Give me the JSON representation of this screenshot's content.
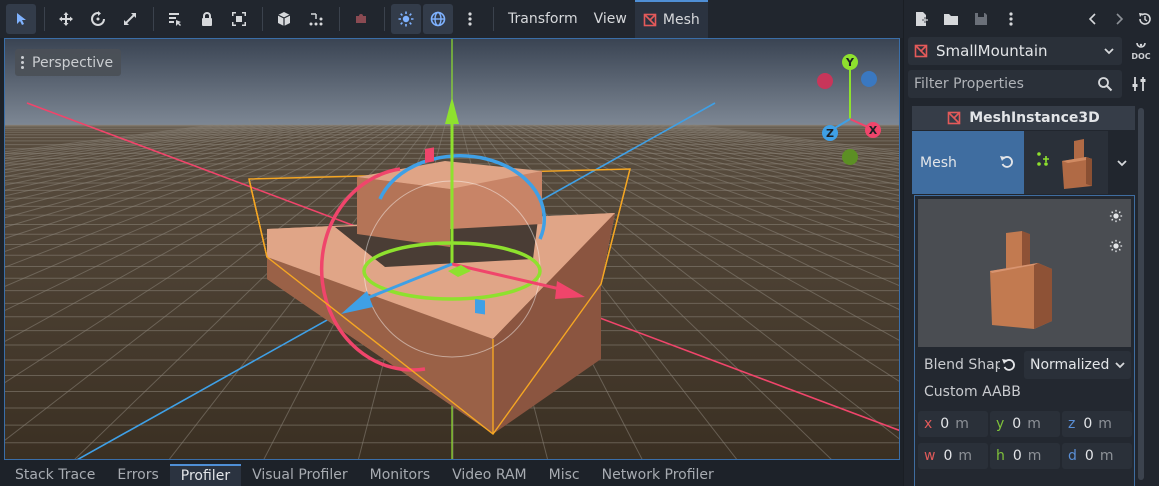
{
  "toolbar": {
    "menus": {
      "transform": "Transform",
      "view": "View",
      "mesh": "Mesh"
    }
  },
  "viewport": {
    "perspective_label": "Perspective",
    "gizmo_axes": {
      "x": "X",
      "y": "Y",
      "z": "Z"
    }
  },
  "bottom_tabs": [
    "Stack Trace",
    "Errors",
    "Profiler",
    "Visual Profiler",
    "Monitors",
    "Video RAM",
    "Misc",
    "Network Profiler"
  ],
  "inspector": {
    "object_name": "SmallMountain",
    "doc_label": "DOC",
    "filter_placeholder": "Filter Properties",
    "section_title": "MeshInstance3D",
    "mesh_label": "Mesh",
    "blend_label": "Blend Shap",
    "blend_value": "Normalized",
    "aabb_label": "Custom AABB",
    "aabb": {
      "x": {
        "axis": "x",
        "value": "0",
        "unit": "m"
      },
      "y": {
        "axis": "y",
        "value": "0",
        "unit": "m"
      },
      "z": {
        "axis": "z",
        "value": "0",
        "unit": "m"
      },
      "w": {
        "axis": "w",
        "value": "0",
        "unit": "m"
      },
      "h": {
        "axis": "h",
        "value": "0",
        "unit": "m"
      },
      "d": {
        "axis": "d",
        "value": "0",
        "unit": "m"
      }
    }
  },
  "colors": {
    "accent": "#4f8fd6",
    "axis_x": "#f0456b",
    "axis_y": "#8ee12e",
    "axis_z": "#3fa0e6",
    "selection": "#f5a623",
    "mesh_node": "#e45a5a"
  }
}
